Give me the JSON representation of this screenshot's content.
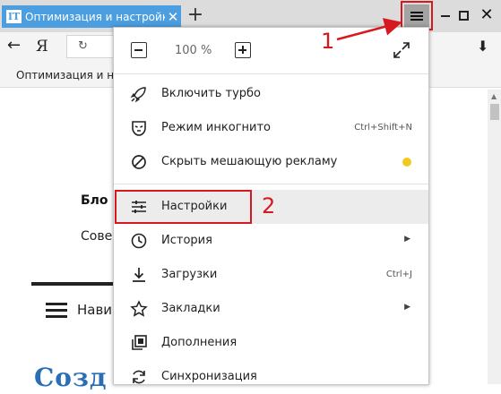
{
  "tab": {
    "favicon": "IT",
    "title": "Оптимизация и настройк",
    "close": "✕"
  },
  "toolbar": {
    "new_tab": "+",
    "window_close": "✕"
  },
  "nav": {
    "back": "←",
    "logo": "Я",
    "reload": "↻",
    "download": "⬇"
  },
  "bookmark_bar": {
    "item": "Оптимизация и на"
  },
  "page": {
    "blog_title": "Бло",
    "blog_sub": "Сове",
    "nav_label": "Нави",
    "big_heading": "Созд"
  },
  "menu": {
    "zoom_value": "100 %",
    "items": [
      {
        "label": "Включить турбо",
        "icon": "rocket-icon"
      },
      {
        "label": "Режим инкогнито",
        "shortcut": "Ctrl+Shift+N",
        "icon": "mask-icon"
      },
      {
        "label": "Скрыть мешающую рекламу",
        "icon": "block-icon",
        "status_color": "#f2ca1d"
      },
      {
        "label": "Настройки",
        "icon": "sliders-icon"
      },
      {
        "label": "История",
        "icon": "clock-icon",
        "arrow": "▶"
      },
      {
        "label": "Загрузки",
        "shortcut": "Ctrl+J",
        "icon": "download-icon"
      },
      {
        "label": "Закладки",
        "icon": "star-icon",
        "arrow": "▶"
      },
      {
        "label": "Дополнения",
        "icon": "extensions-icon"
      },
      {
        "label": "Синхронизация",
        "icon": "sync-icon"
      }
    ]
  },
  "annotations": {
    "step1": "1",
    "step2": "2",
    "color": "#d7191f"
  },
  "colors": {
    "tab_active": "#4b9ee0",
    "menu_button_active": "#a3a3a3",
    "link_blue": "#2a6fb5"
  }
}
